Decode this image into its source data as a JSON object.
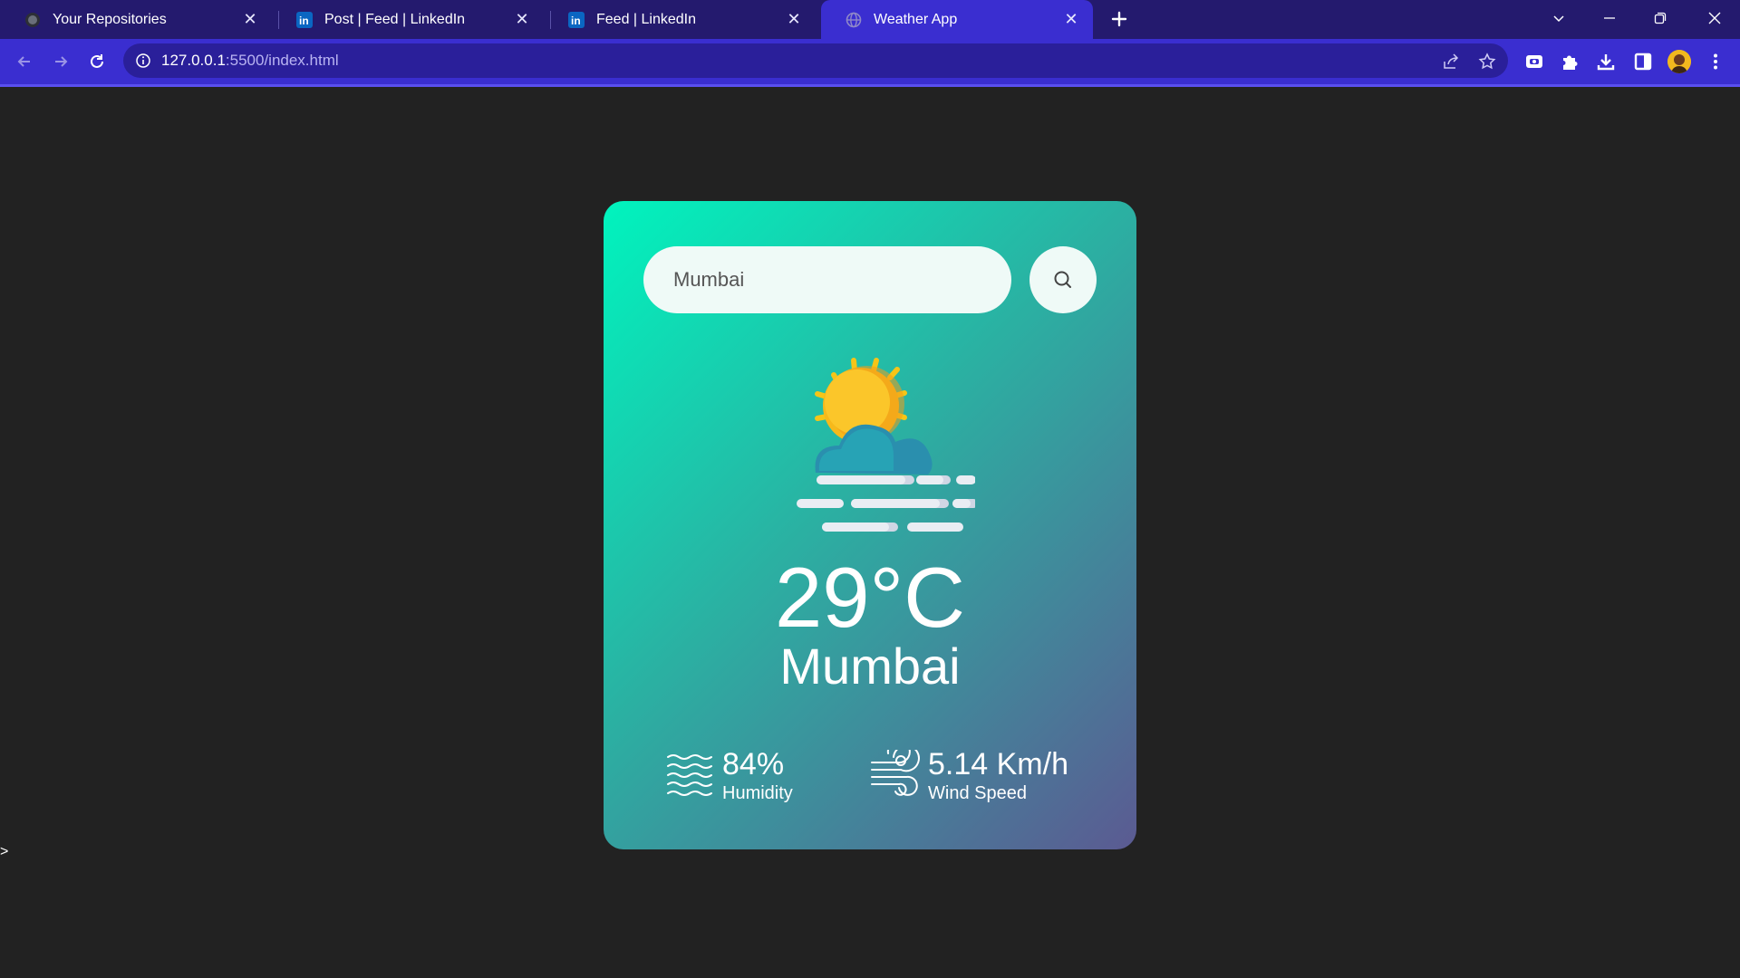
{
  "browser": {
    "tabs": [
      {
        "title": "Your Repositories",
        "favicon": "github-icon"
      },
      {
        "title": "Post | Feed | LinkedIn",
        "favicon": "linkedin-icon"
      },
      {
        "title": "Feed | LinkedIn",
        "favicon": "linkedin-icon"
      },
      {
        "title": "Weather App",
        "favicon": "globe-icon",
        "active": true
      }
    ],
    "url_host": "127.0.0.1",
    "url_rest": ":5500/index.html",
    "colors": {
      "tabstrip": "#241a6e",
      "toolbar": "#3a2ed0",
      "omnibox": "#2a1f9a"
    }
  },
  "page": {
    "stray_text": ">",
    "search": {
      "value": "Mumbai"
    },
    "weather": {
      "icon": "partly-cloudy-mist-icon",
      "temperature": "29°C",
      "city": "Mumbai",
      "humidity": {
        "value": "84%",
        "label": "Humidity",
        "icon": "humidity-waves-icon"
      },
      "wind": {
        "value": "5.14 Km/h",
        "label": "Wind Speed",
        "icon": "wind-icon"
      }
    },
    "card_gradient": [
      "#00f4be",
      "#2bb0a2",
      "#5b5a92"
    ]
  }
}
